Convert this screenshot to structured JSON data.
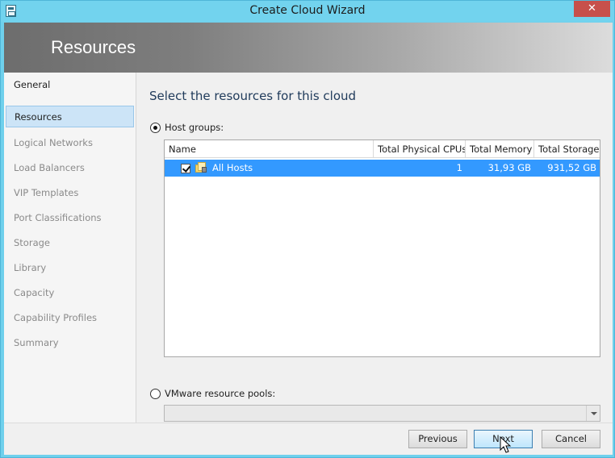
{
  "window": {
    "title": "Create Cloud Wizard",
    "close_glyph": "✕"
  },
  "banner": {
    "title": "Resources"
  },
  "nav": {
    "items": [
      {
        "label": "General",
        "state": "done"
      },
      {
        "label": "Resources",
        "state": "active"
      },
      {
        "label": "Logical Networks",
        "state": "pending"
      },
      {
        "label": "Load Balancers",
        "state": "pending"
      },
      {
        "label": "VIP Templates",
        "state": "pending"
      },
      {
        "label": "Port Classifications",
        "state": "pending"
      },
      {
        "label": "Storage",
        "state": "pending"
      },
      {
        "label": "Library",
        "state": "pending"
      },
      {
        "label": "Capacity",
        "state": "pending"
      },
      {
        "label": "Capability Profiles",
        "state": "pending"
      },
      {
        "label": "Summary",
        "state": "pending"
      }
    ]
  },
  "main": {
    "heading": "Select the resources for this cloud",
    "host_groups_label": "Host groups:",
    "host_groups_selected": true,
    "table": {
      "columns": [
        "Name",
        "Total Physical CPUs",
        "Total Memory",
        "Total Storage"
      ],
      "rows": [
        {
          "name": "All Hosts",
          "cpus": "1",
          "memory": "31,93 GB",
          "storage": "931,52 GB",
          "checked": true,
          "selected": true
        }
      ]
    },
    "vmware_label": "VMware resource pools:",
    "vmware_selected": false,
    "vmware_value": ""
  },
  "footer": {
    "previous_label": "Previous",
    "next_label": "Next",
    "cancel_label": "Cancel"
  },
  "colors": {
    "window_frame": "#6fd0ec",
    "selection": "#3399ff",
    "nav_active": "#cce4f7",
    "close_button": "#c7504b"
  }
}
